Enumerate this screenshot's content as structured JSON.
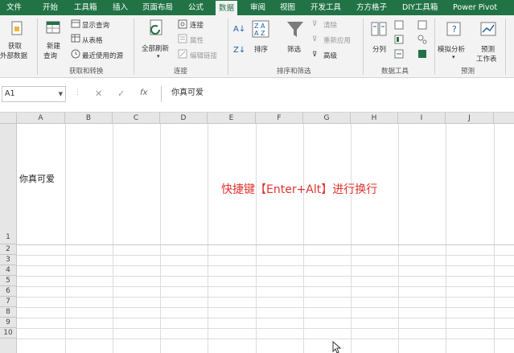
{
  "tabs": [
    {
      "label": "文件",
      "active": false
    },
    {
      "label": "开始",
      "active": false
    },
    {
      "label": "工具箱",
      "active": false
    },
    {
      "label": "插入",
      "active": false
    },
    {
      "label": "页面布局",
      "active": false
    },
    {
      "label": "公式",
      "active": false
    },
    {
      "label": "数据",
      "active": true
    },
    {
      "label": "审阅",
      "active": false
    },
    {
      "label": "视图",
      "active": false
    },
    {
      "label": "开发工具",
      "active": false
    },
    {
      "label": "方方格子",
      "active": false
    },
    {
      "label": "DIY工具箱",
      "active": false
    },
    {
      "label": "Power Pivot",
      "active": false
    }
  ],
  "ribbon": {
    "get_transform": {
      "get_external_1": "获取",
      "get_external_2": "外部数据",
      "new_query_1": "新建",
      "new_query_2": "查询",
      "show_queries": "显示查询",
      "from_table": "从表格",
      "recent_sources": "最近使用的源",
      "label": "获取和转换"
    },
    "connections": {
      "refresh_all": "全部刷新",
      "connections": "连接",
      "properties": "属性",
      "edit_links": "编辑链接",
      "label": "连接"
    },
    "sort_filter": {
      "sort": "排序",
      "filter": "筛选",
      "clear": "清除",
      "reapply": "重新应用",
      "advanced": "高级",
      "label": "排序和筛选"
    },
    "data_tools": {
      "text_to_columns": "分列",
      "label": "数据工具"
    },
    "forecast": {
      "what_if": "模拟分析",
      "forecast_sheet_1": "预测",
      "forecast_sheet_2": "工作表",
      "label": "预测"
    }
  },
  "formula_bar": {
    "name_box": "A1",
    "fx": "fx",
    "content": "你真可爱"
  },
  "grid": {
    "columns": [
      "A",
      "B",
      "C",
      "D",
      "E",
      "F",
      "G",
      "H",
      "I",
      "J"
    ],
    "rows": [
      "1",
      "2",
      "3",
      "4",
      "5",
      "6",
      "7",
      "8",
      "9",
      "10"
    ],
    "cell_a1": "你真可爱",
    "hint_text": "快捷键【Enter+Alt】进行换行"
  },
  "colors": {
    "ribbon_green": "#217346",
    "hint_red": "#e0332d"
  }
}
